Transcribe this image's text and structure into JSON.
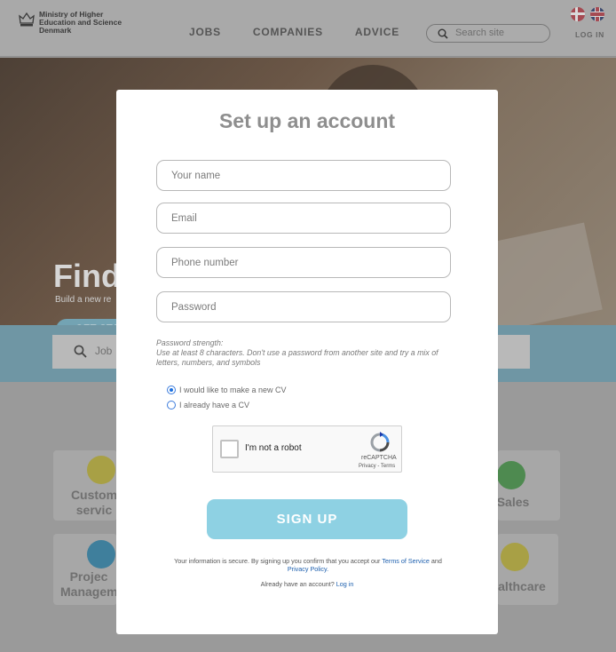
{
  "header": {
    "logo_text": "Ministry of Higher Education and Science Denmark",
    "nav": [
      "JOBS",
      "COMPANIES",
      "ADVICE"
    ],
    "search_placeholder": "Search site",
    "login_label": "LOG IN"
  },
  "hero": {
    "title": "Find",
    "subtitle": "Build a new re",
    "cta": "GET STA"
  },
  "job_search": {
    "placeholder": "Job"
  },
  "categories": [
    {
      "label": "Custom\nservic"
    },
    {
      "label": "Sales"
    },
    {
      "label": "Projec\nManagem"
    },
    {
      "label": "althcare"
    }
  ],
  "modal": {
    "title": "Set up an account",
    "fields": {
      "name_placeholder": "Your name",
      "email_placeholder": "Email",
      "phone_placeholder": "Phone number",
      "password_placeholder": "Password"
    },
    "password_strength_label": "Password strength:",
    "password_help": "Use at least 8 characters. Don't use a password from another site and try a mix of letters, numbers, and symbols",
    "cv_options": [
      {
        "label": "I would like to make a new CV",
        "selected": true
      },
      {
        "label": "I already have a CV",
        "selected": false
      }
    ],
    "captcha": {
      "label": "I'm not a robot",
      "brand": "reCAPTCHA",
      "privacy": "Privacy",
      "terms": "Terms"
    },
    "signup_label": "SIGN UP",
    "legal_prefix": "Your information is secure. By signing up you confirm that you accept our",
    "terms_link": "Terms of Service",
    "legal_and": "and",
    "privacy_link": "Privacy Policy.",
    "have_account": "Already have an account?",
    "login_link": "Log in"
  },
  "colors": {
    "accent": "#8ed1e3",
    "link": "#1d5fae",
    "band": "#6f96a4"
  }
}
